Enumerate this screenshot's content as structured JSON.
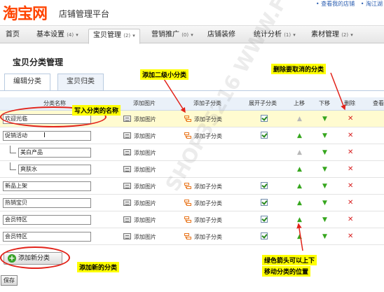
{
  "header": {
    "logo": "淘宝网",
    "subtitle": "店铺管理平台",
    "links": [
      "• 查看我的店铺",
      "• 淘江湖"
    ]
  },
  "nav": [
    {
      "label": "首页",
      "count": "",
      "active": false
    },
    {
      "label": "基本设置",
      "count": "(4)",
      "active": false
    },
    {
      "label": "宝贝管理",
      "count": "(2)",
      "active": true
    },
    {
      "label": "营销推广",
      "count": "(0)",
      "active": false
    },
    {
      "label": "店铺装修",
      "count": "",
      "active": false
    },
    {
      "label": "统计分析",
      "count": "(1)",
      "active": false
    },
    {
      "label": "素材管理",
      "count": "(2)",
      "active": false
    }
  ],
  "page": {
    "title": "宝贝分类管理",
    "tabs": [
      "编辑分类",
      "宝贝归类"
    ]
  },
  "table": {
    "headers": [
      "分类名称",
      "添加图片",
      "添加子分类",
      "展开子分类",
      "上移",
      "下移",
      "删除",
      "查看"
    ],
    "rows": [
      {
        "name": "欢迎光临",
        "level": 1,
        "add_image": "添加图片",
        "add_sub": "添加子分类",
        "expand": true,
        "up": "gray",
        "highlight": true
      },
      {
        "name": "促销活动",
        "level": 1,
        "add_image": "添加图片",
        "add_sub": "添加子分类",
        "expand": true,
        "up": "green",
        "highlight": false
      },
      {
        "name": "美白产品",
        "level": 2,
        "add_image": "添加图片",
        "add_sub": "",
        "expand": false,
        "up": "gray",
        "highlight": false
      },
      {
        "name": "爽肤水",
        "level": 2,
        "add_image": "添加图片",
        "add_sub": "",
        "expand": false,
        "up": "green",
        "highlight": false
      },
      {
        "name": "新品上架",
        "level": 1,
        "add_image": "添加图片",
        "add_sub": "添加子分类",
        "expand": true,
        "up": "green",
        "highlight": false
      },
      {
        "name": "热销宝贝",
        "level": 1,
        "add_image": "添加图片",
        "add_sub": "添加子分类",
        "expand": true,
        "up": "green",
        "highlight": false
      },
      {
        "name": "会员特区",
        "level": 1,
        "add_image": "添加图片",
        "add_sub": "添加子分类",
        "expand": true,
        "up": "green",
        "highlight": false
      },
      {
        "name": "会员特区",
        "level": 1,
        "add_image": "添加图片",
        "add_sub": "添加子分类",
        "expand": true,
        "up": "green",
        "highlight": false
      }
    ]
  },
  "buttons": {
    "add_category": "添加新分类",
    "save": "保存"
  },
  "annotations": {
    "write_name": "写入分类的名称",
    "add_sub": "添加二级小分类",
    "delete": "删除要取消的分类",
    "add_new": "添加新的分类",
    "arrows_line1": "绿色箭头可以上下",
    "arrows_line2": "移动分类的位置"
  },
  "watermark": "SHOP35216 WWW.FH19.COM",
  "colors": {
    "logo": "#ff4400",
    "callout": "#ffff00",
    "annotation_red": "#e2231a",
    "arrow_green": "#36a61e",
    "delete_red": "#d81f1f",
    "highlight_row": "#fffbd0"
  }
}
